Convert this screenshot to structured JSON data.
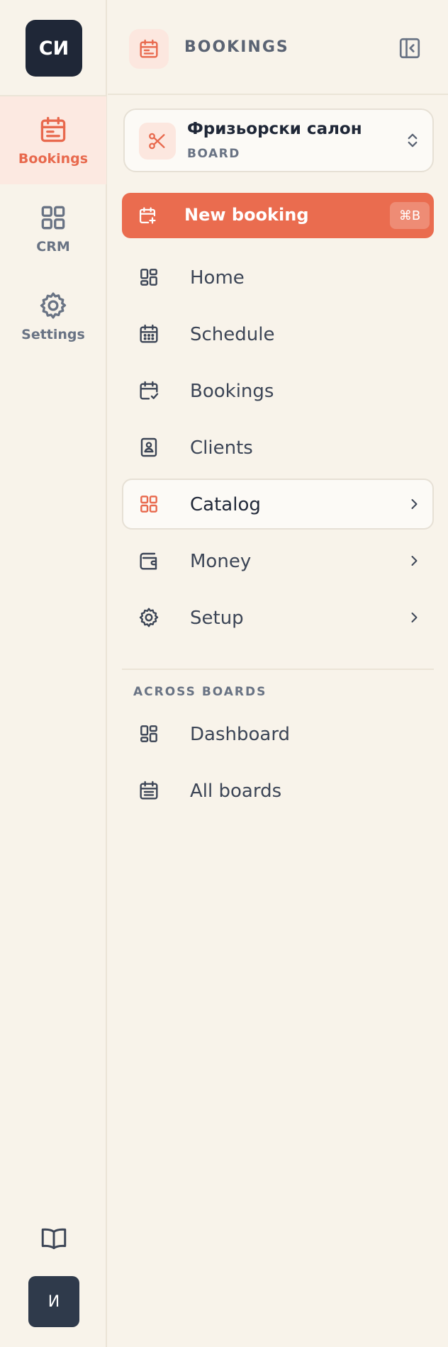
{
  "rail": {
    "logo_text": "СИ",
    "items": [
      {
        "label": "Bookings",
        "icon": "calendar-icon",
        "active": true
      },
      {
        "label": "CRM",
        "icon": "grid-icon",
        "active": false
      },
      {
        "label": "Settings",
        "icon": "gear-icon",
        "active": false
      }
    ],
    "bottom_icon": "book-icon",
    "avatar_text": "И"
  },
  "header": {
    "title": "BOOKINGS",
    "icon": "calendar-icon",
    "collapse_icon": "sidebar-collapse-icon"
  },
  "board": {
    "name": "Фризьорски салон",
    "subtitle": "BOARD",
    "icon": "scissors-icon"
  },
  "new_booking": {
    "label": "New booking",
    "shortcut": "⌘B"
  },
  "nav": [
    {
      "label": "Home",
      "icon": "dashboard-icon"
    },
    {
      "label": "Schedule",
      "icon": "calendar-grid-icon"
    },
    {
      "label": "Bookings",
      "icon": "calendar-check-icon"
    },
    {
      "label": "Clients",
      "icon": "contact-book-icon"
    },
    {
      "label": "Catalog",
      "icon": "grid-icon",
      "selected": true,
      "has_submenu": true
    },
    {
      "label": "Money",
      "icon": "wallet-icon",
      "has_submenu": true
    },
    {
      "label": "Setup",
      "icon": "gear-icon",
      "has_submenu": true
    }
  ],
  "across_boards": {
    "title": "ACROSS BOARDS",
    "items": [
      {
        "label": "Dashboard",
        "icon": "dashboard-icon"
      },
      {
        "label": "All boards",
        "icon": "calendar-list-icon"
      }
    ]
  },
  "colors": {
    "accent": "#ea6c4f",
    "background": "#f8f3ea",
    "dark": "#1f2737",
    "muted": "#697384"
  }
}
